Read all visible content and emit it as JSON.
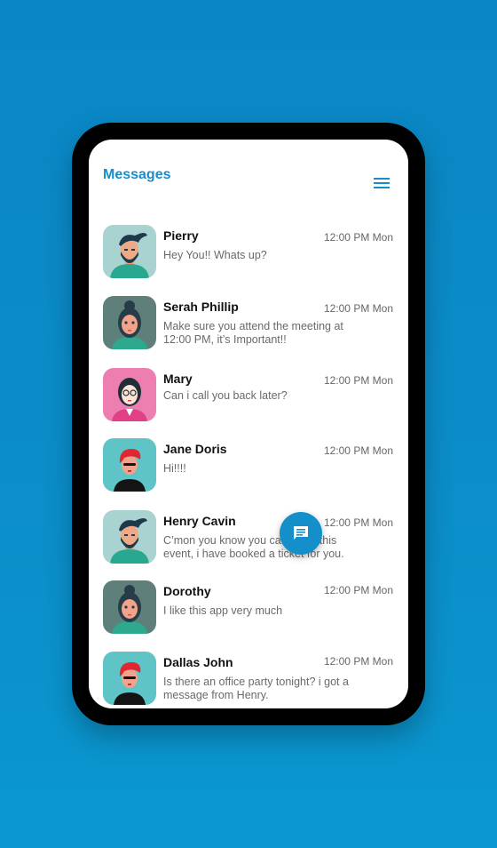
{
  "header": {
    "title": "Messages",
    "menu_icon": "hamburger-menu-icon"
  },
  "colors": {
    "accent": "#1a8cc7",
    "background": "#0b8dc9",
    "fab": "#148fc9"
  },
  "messages": [
    {
      "name": "Pierry",
      "time": "12:00 PM Mon",
      "text": "Hey You!! Whats up?",
      "avatar": "bearded-man-avatar"
    },
    {
      "name": "Serah Phillip",
      "time": "12:00 PM Mon",
      "text": "Make sure you attend the meeting at 12:00 PM, it’s Important!!",
      "avatar": "woman-bun-avatar"
    },
    {
      "name": "Mary",
      "time": "12:00 PM Mon",
      "text": "Can i call you back later?",
      "avatar": "woman-glasses-avatar"
    },
    {
      "name": "Jane Doris",
      "time": "12:00 PM Mon",
      "text": "Hi!!!!",
      "avatar": "redhead-woman-avatar"
    },
    {
      "name": "Henry Cavin",
      "time": "12:00 PM Mon",
      "text": "C’mon you know you cant miss this event, i have booked a ticket for you.",
      "avatar": "bearded-man-avatar"
    },
    {
      "name": "Dorothy",
      "time": "12:00 PM Mon",
      "text": "I like this app very much",
      "avatar": "woman-bun-avatar"
    },
    {
      "name": "Dallas John",
      "time": "12:00 PM Mon",
      "text": "Is there an office party tonight? i got a message from Henry.",
      "avatar": "redhead-woman-avatar"
    }
  ],
  "fab": {
    "icon": "message-icon"
  }
}
